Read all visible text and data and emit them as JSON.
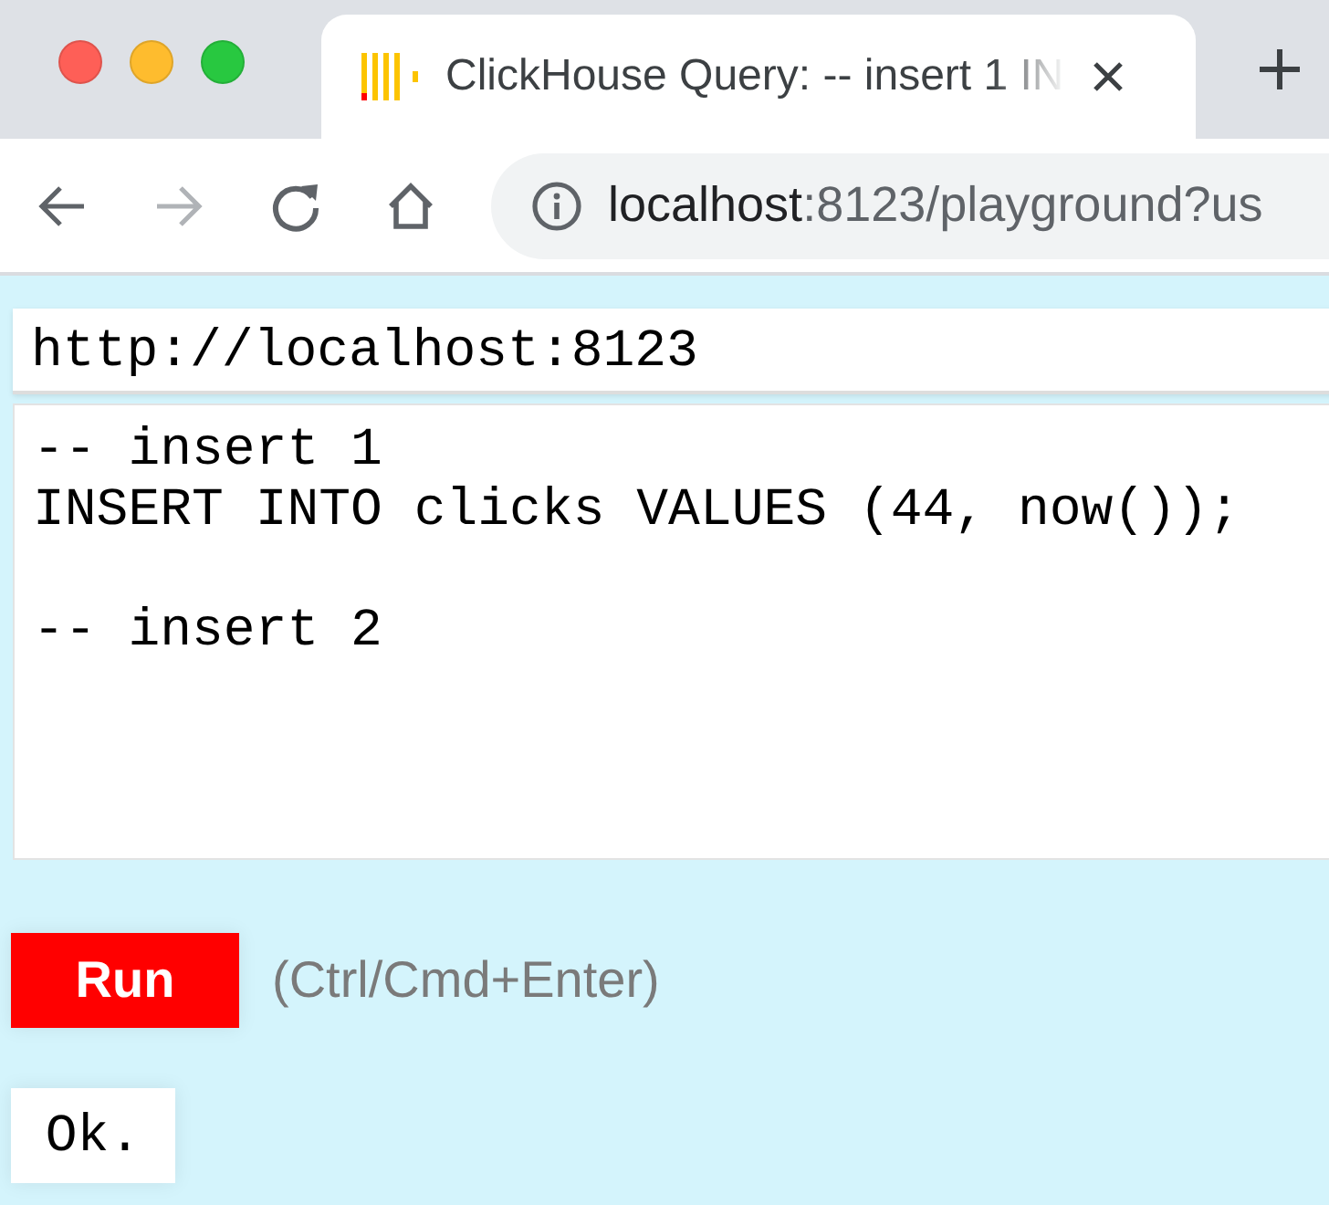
{
  "browser": {
    "tab": {
      "title": "ClickHouse Query: -- insert 1 IN",
      "selected": true
    },
    "address": {
      "host": "localhost",
      "rest": ":8123/playground?us"
    }
  },
  "page": {
    "server_url": "http://localhost:8123",
    "query": "-- insert 1\nINSERT INTO clicks VALUES (44, now());\n\n-- insert 2",
    "run_button": "Run",
    "hint": "(Ctrl/Cmd+Enter)",
    "result": "Ok."
  }
}
